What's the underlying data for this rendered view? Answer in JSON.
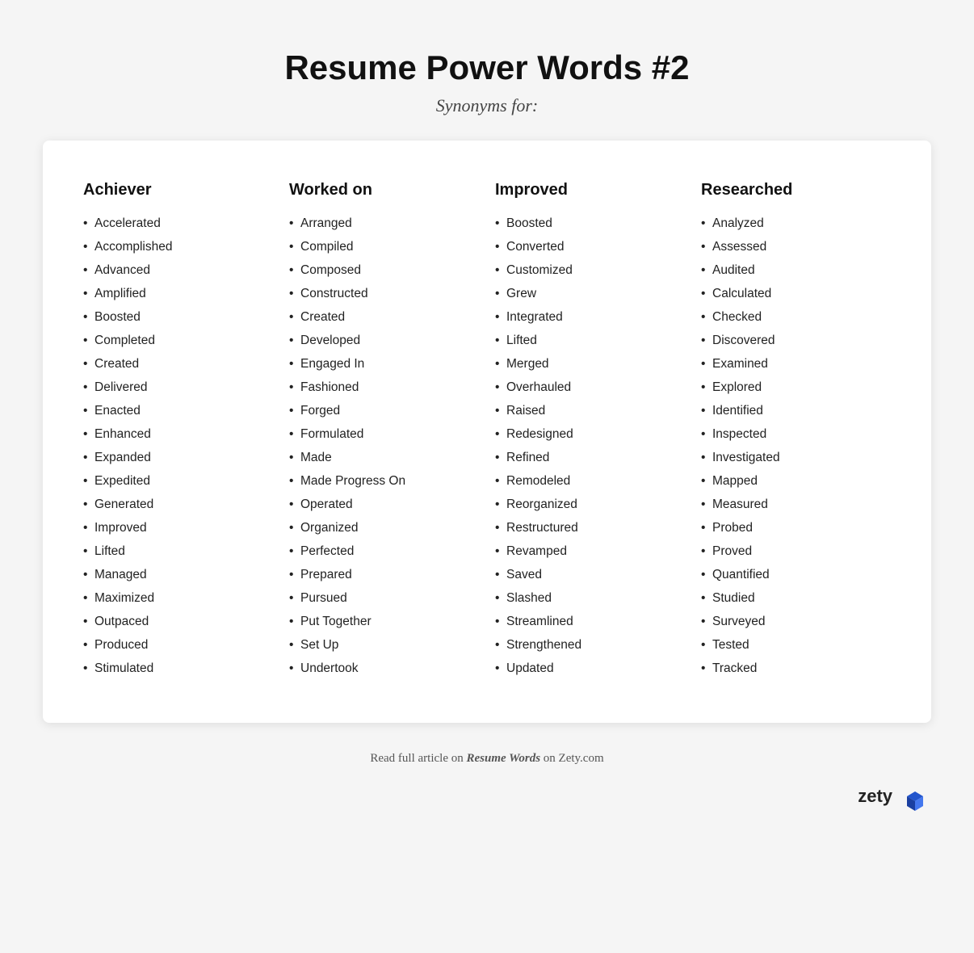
{
  "header": {
    "title": "Resume Power Words #2",
    "subtitle": "Synonyms for:"
  },
  "columns": [
    {
      "title": "Achiever",
      "items": [
        "Accelerated",
        "Accomplished",
        "Advanced",
        "Amplified",
        "Boosted",
        "Completed",
        "Created",
        "Delivered",
        "Enacted",
        "Enhanced",
        "Expanded",
        "Expedited",
        "Generated",
        "Improved",
        "Lifted",
        "Managed",
        "Maximized",
        "Outpaced",
        "Produced",
        "Stimulated"
      ]
    },
    {
      "title": "Worked on",
      "items": [
        "Arranged",
        "Compiled",
        "Composed",
        "Constructed",
        "Created",
        "Developed",
        "Engaged In",
        "Fashioned",
        "Forged",
        "Formulated",
        "Made",
        "Made Progress On",
        "Operated",
        "Organized",
        "Perfected",
        "Prepared",
        "Pursued",
        "Put Together",
        "Set Up",
        "Undertook"
      ]
    },
    {
      "title": "Improved",
      "items": [
        "Boosted",
        "Converted",
        "Customized",
        "Grew",
        "Integrated",
        "Lifted",
        "Merged",
        "Overhauled",
        "Raised",
        "Redesigned",
        "Refined",
        "Remodeled",
        "Reorganized",
        "Restructured",
        "Revamped",
        "Saved",
        "Slashed",
        "Streamlined",
        "Strengthened",
        "Updated"
      ]
    },
    {
      "title": "Researched",
      "items": [
        "Analyzed",
        "Assessed",
        "Audited",
        "Calculated",
        "Checked",
        "Discovered",
        "Examined",
        "Explored",
        "Identified",
        "Inspected",
        "Investigated",
        "Mapped",
        "Measured",
        "Probed",
        "Proved",
        "Quantified",
        "Studied",
        "Surveyed",
        "Tested",
        "Tracked"
      ]
    }
  ],
  "footer": {
    "text_before": "Read full article on ",
    "text_italic": "Resume Words",
    "text_after": " on Zety.com"
  },
  "logo": {
    "text": "zety"
  }
}
